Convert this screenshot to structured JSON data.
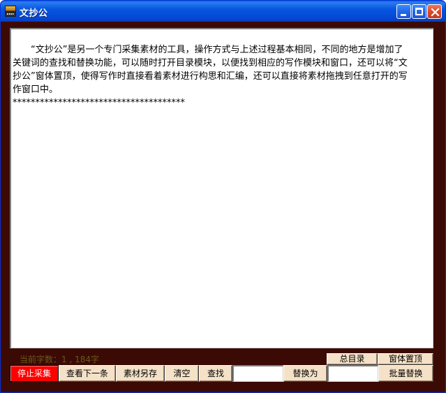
{
  "window": {
    "title": "文抄公"
  },
  "editor": {
    "paragraph": "“文抄公”是另一个专门采集素材的工具，操作方式与上述过程基本相同，不同的地方是增加了关键词的查找和替换功能，可以随时打开目录模块，以便找到相应的写作模块和窗口，还可以将“文抄公”窗体置顶，使得写作时直接看着素材进行构思和汇编，还可以直接将素材拖拽到任意打开的写作窗口中。",
    "separator": "**************************************"
  },
  "status": {
    "text": "当前字数：1 , 184字"
  },
  "buttons": {
    "stop_collect": "停止采集",
    "view_next": "查看下一条",
    "save_as": "素材另存",
    "clear": "清空",
    "find": "查找",
    "replace_with": "替换为",
    "batch_replace": "批量替换",
    "master_index": "总目录",
    "window_on_top": "窗体置顶"
  },
  "inputs": {
    "find_value": "",
    "replace_value": ""
  },
  "colors": {
    "frame": "#3b0a05",
    "button_face": "#f4e1c7",
    "stop_button": "#ff0000",
    "titlebar": "#0756e0"
  }
}
